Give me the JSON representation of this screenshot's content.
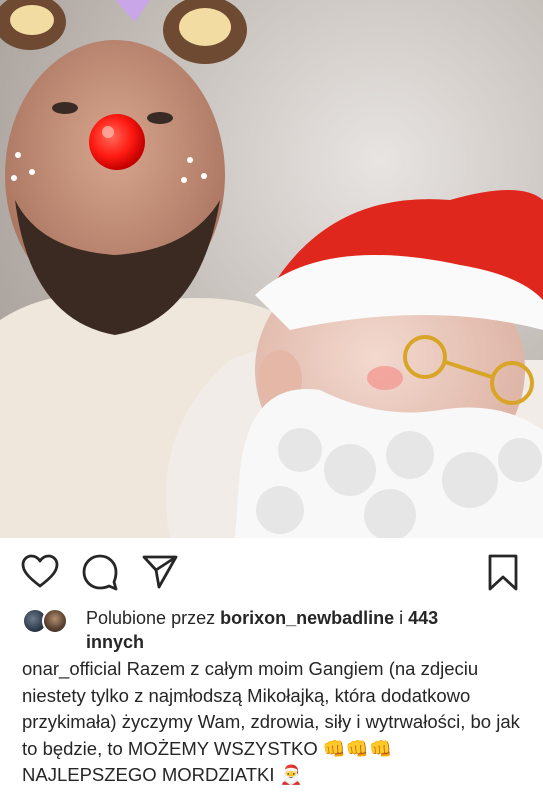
{
  "post": {
    "image_alt_icons": [
      "reindeer-filter",
      "santa-hat-filter"
    ]
  },
  "actions": {
    "like_icon": "heart-icon",
    "comment_icon": "comment-icon",
    "share_icon": "paper-plane-icon",
    "save_icon": "bookmark-icon"
  },
  "likes": {
    "prefix": "Polubione przez ",
    "user": "borixon_newbadline",
    "middle": " i ",
    "count": "443",
    "suffix": "innych"
  },
  "caption": {
    "author": "onar_official",
    "text": "Razem z całym moim Gangiem (na zdjeciu niestety tylko z najmłodszą Mikołajką, która dodatkowo przykimała) życzymy Wam, zdrowia, siły i wytrwałości, bo jak to będzie, to MOŻEMY WSZYSTKO 👊👊👊 NAJLEPSZEGO MORDZIATKI 🎅"
  },
  "colors": {
    "text": "#262626",
    "icon": "#262626"
  }
}
